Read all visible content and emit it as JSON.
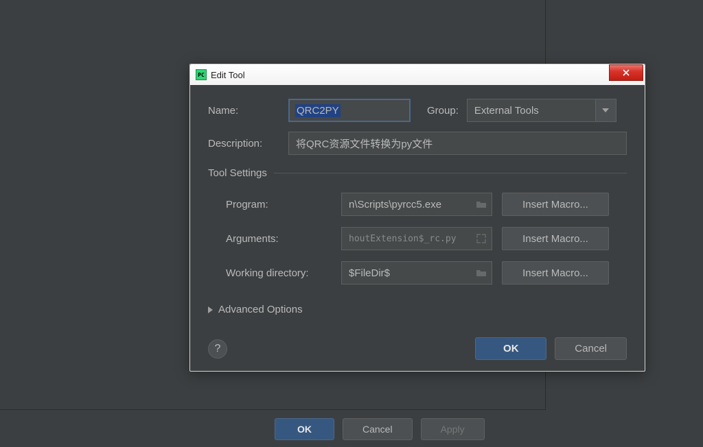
{
  "dialog": {
    "title": "Edit Tool",
    "name_label": "Name:",
    "name_value": "QRC2PY",
    "group_label": "Group:",
    "group_value": "External Tools",
    "description_label": "Description:",
    "description_value": "将QRC资源文件转换为py文件",
    "tool_settings_label": "Tool Settings",
    "program_label": "Program:",
    "program_value": "n\\Scripts\\pyrcc5.exe",
    "arguments_label": "Arguments:",
    "arguments_value": "houtExtension$_rc.py",
    "workdir_label": "Working directory:",
    "workdir_value": "$FileDir$",
    "insert_macro_label": "Insert Macro...",
    "advanced_label": "Advanced Options",
    "help_label": "?",
    "ok_label": "OK",
    "cancel_label": "Cancel"
  },
  "background": {
    "ok_label": "OK",
    "cancel_label": "Cancel",
    "apply_label": "Apply"
  }
}
